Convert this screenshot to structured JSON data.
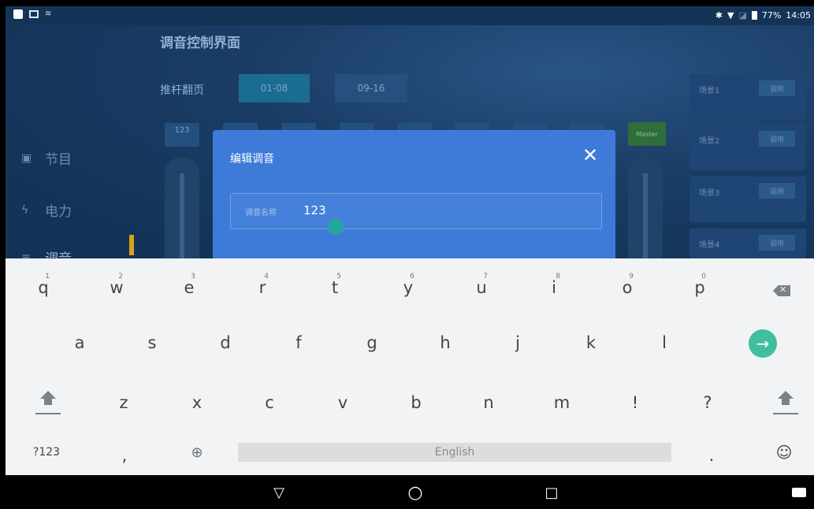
{
  "status_bar": {
    "battery": "77%",
    "time": "14:05"
  },
  "app": {
    "title": "调音控制界面",
    "fader_page_label": "推杆翻页",
    "pages": [
      "01-08",
      "09-16"
    ],
    "first_channel": "123",
    "master_label": "Master",
    "nav": [
      {
        "icon": "program-icon",
        "label": "节目"
      },
      {
        "icon": "power-icon",
        "label": "电力"
      },
      {
        "icon": "mixer-icon",
        "label": "调音"
      }
    ],
    "scenes": [
      {
        "name": "场景1",
        "button": "调用"
      },
      {
        "name": "场景2",
        "button": "调用"
      },
      {
        "name": "场景3",
        "button": "调用"
      },
      {
        "name": "场景4",
        "button": "调用"
      }
    ]
  },
  "dialog": {
    "title": "编辑调音",
    "close_icon": "close-icon",
    "name_label": "调音名称",
    "name_value": "123"
  },
  "keyboard": {
    "row1": [
      {
        "k": "q",
        "hint": "1"
      },
      {
        "k": "w",
        "hint": "2"
      },
      {
        "k": "e",
        "hint": "3"
      },
      {
        "k": "r",
        "hint": "4"
      },
      {
        "k": "t",
        "hint": "5"
      },
      {
        "k": "y",
        "hint": "6"
      },
      {
        "k": "u",
        "hint": "7"
      },
      {
        "k": "i",
        "hint": "8"
      },
      {
        "k": "o",
        "hint": "9"
      },
      {
        "k": "p",
        "hint": "0"
      }
    ],
    "row2": [
      "a",
      "s",
      "d",
      "f",
      "g",
      "h",
      "j",
      "k",
      "l"
    ],
    "row3": [
      "z",
      "x",
      "c",
      "v",
      "b",
      "n",
      "m",
      "!",
      "?"
    ],
    "symbols_label": "?123",
    "comma": ",",
    "space_label": "English",
    "period": ".",
    "emoji_icon": "☺",
    "globe_icon": "🌐",
    "enter_icon": "→"
  },
  "nav_bar": {
    "back": "▽",
    "home": "○",
    "recents": "□"
  }
}
